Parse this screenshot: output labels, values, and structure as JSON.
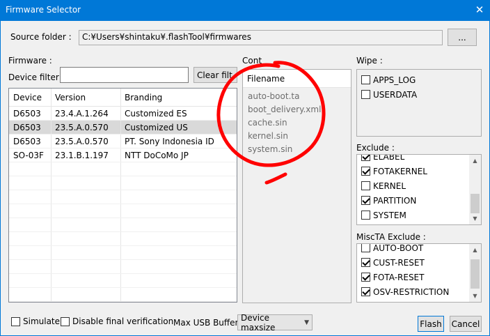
{
  "window": {
    "title": "Firmware Selector",
    "close_glyph": "✕"
  },
  "source": {
    "label": "Source folder :",
    "path": "C:¥Users¥shintaku¥.flashTool¥firmwares",
    "browse_label": "..."
  },
  "firmware": {
    "label": "Firmware :",
    "filter_label": "Device filter :",
    "filter_value": "",
    "clear_label": "Clear filt",
    "columns": [
      "Device",
      "Version",
      "Branding"
    ],
    "rows": [
      {
        "device": "D6503",
        "version": "23.4.A.1.264",
        "branding": "Customized ES",
        "selected": false
      },
      {
        "device": "D6503",
        "version": "23.5.A.0.570",
        "branding": "Customized US",
        "selected": true
      },
      {
        "device": "D6503",
        "version": "23.5.A.0.570",
        "branding": "PT. Sony Indonesia ID",
        "selected": false
      },
      {
        "device": "SO-03F",
        "version": "23.1.B.1.197",
        "branding": "NTT DoCoMo JP",
        "selected": false
      }
    ]
  },
  "content": {
    "label": "Cont",
    "header": "Filename",
    "files": [
      "auto-boot.ta",
      "boot_delivery.xml",
      "cache.sin",
      "kernel.sin",
      "system.sin"
    ]
  },
  "wipe": {
    "label": "Wipe :",
    "items": [
      {
        "label": "APPS_LOG",
        "checked": false
      },
      {
        "label": "USERDATA",
        "checked": false
      }
    ]
  },
  "exclude": {
    "label": "Exclude :",
    "items": [
      {
        "label": "ELABEL",
        "checked": true
      },
      {
        "label": "FOTAKERNEL",
        "checked": true
      },
      {
        "label": "KERNEL",
        "checked": false
      },
      {
        "label": "PARTITION",
        "checked": true
      },
      {
        "label": "SYSTEM",
        "checked": false
      }
    ]
  },
  "miscta": {
    "label": "MiscTA Exclude :",
    "items": [
      {
        "label": "AUTO-BOOT",
        "checked": false
      },
      {
        "label": "CUST-RESET",
        "checked": true
      },
      {
        "label": "FOTA-RESET",
        "checked": true
      },
      {
        "label": "OSV-RESTRICTION",
        "checked": true
      }
    ]
  },
  "footer": {
    "simulate_label": "Simulate",
    "simulate_checked": false,
    "disable_verify_label": "Disable final verification",
    "disable_verify_checked": false,
    "usb_label": "Max USB Buffer :",
    "usb_value": "Device maxsize",
    "flash_label": "Flash",
    "cancel_label": "Cancel"
  },
  "colors": {
    "titlebar": "#0078d7",
    "annotation": "#ff0000",
    "selection": "#d9d9d9"
  },
  "icons": {
    "close": "close-icon",
    "dropdown": "chevron-down-icon",
    "scroll_up": "scroll-up-icon",
    "scroll_down": "scroll-down-icon"
  }
}
